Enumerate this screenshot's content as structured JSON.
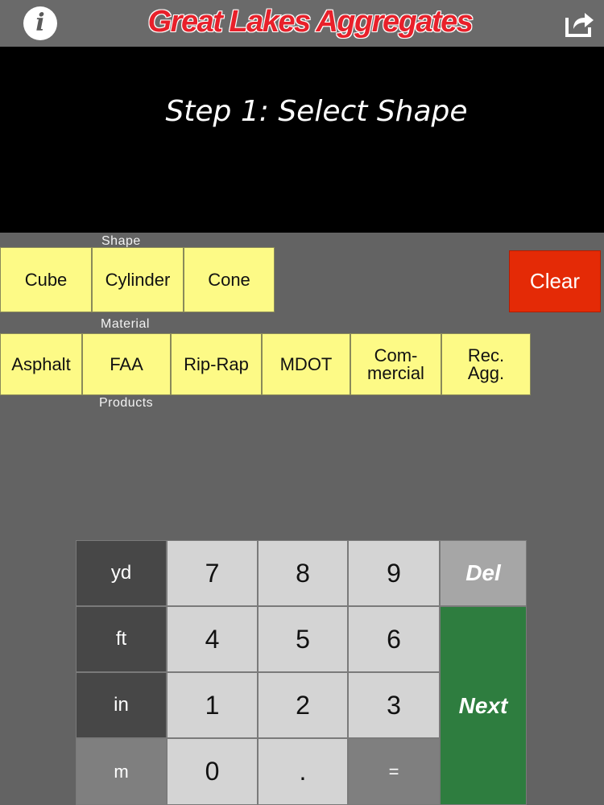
{
  "header": {
    "title": "Great Lakes Aggregates",
    "info_glyph": "i",
    "icons": [
      "info-icon",
      "share-icon"
    ]
  },
  "display": {
    "step_text": "Step 1: Select Shape"
  },
  "shape": {
    "label": "Shape",
    "buttons": [
      "Cube",
      "Cylinder",
      "Cone"
    ],
    "clear_label": "Clear"
  },
  "material": {
    "label": "Material",
    "buttons": [
      "Asphalt",
      "FAA",
      "Rip-Rap",
      "MDOT",
      "Com-\nmercial",
      "Rec.\nAgg."
    ],
    "footer_label": "Products"
  },
  "keypad": {
    "units": [
      "yd",
      "ft",
      "in",
      "m"
    ],
    "digits": [
      "7",
      "8",
      "9",
      "4",
      "5",
      "6",
      "1",
      "2",
      "3",
      "0",
      "."
    ],
    "equals": "=",
    "del": "Del",
    "next": "Next"
  },
  "colors": {
    "background": "#636363",
    "title_red": "#e8202a",
    "button_yellow": "#fdfa86",
    "clear_red": "#e42a06",
    "next_green": "#2e7d3f"
  }
}
